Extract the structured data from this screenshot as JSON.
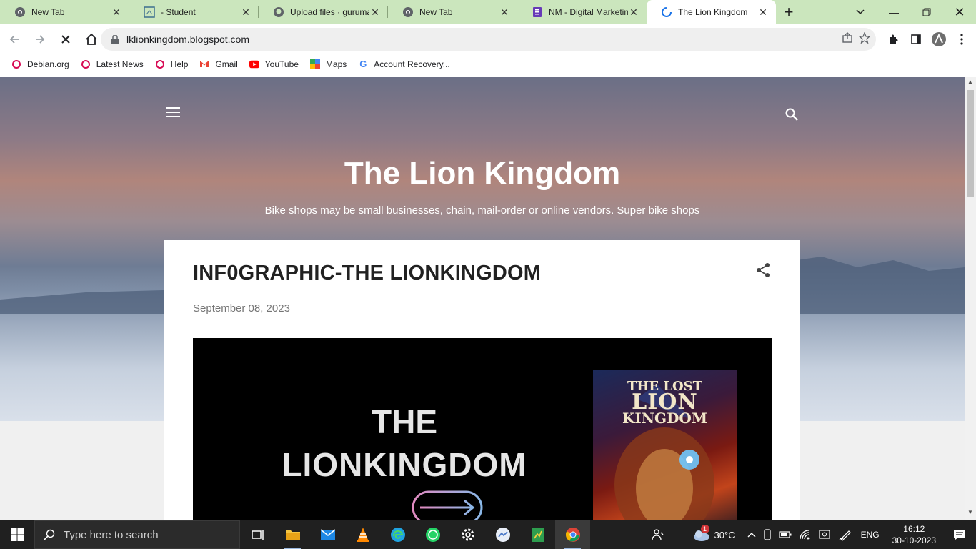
{
  "tabs": [
    {
      "title": "New Tab",
      "icon": "chrome-icon"
    },
    {
      "title": "- Student",
      "icon": "document-icon"
    },
    {
      "title": "Upload files · guruma",
      "icon": "github-icon"
    },
    {
      "title": "New Tab",
      "icon": "chrome-icon"
    },
    {
      "title": "NM - Digital Marketin",
      "icon": "forms-icon"
    },
    {
      "title": "The Lion Kingdom",
      "icon": "blogger-icon",
      "active": true
    }
  ],
  "address_bar": {
    "url": "lklionkingdom.blogspot.com"
  },
  "bookmarks": [
    {
      "label": "Debian.org"
    },
    {
      "label": "Latest News"
    },
    {
      "label": "Help"
    },
    {
      "label": "Gmail"
    },
    {
      "label": "YouTube"
    },
    {
      "label": "Maps"
    },
    {
      "label": "Account Recovery..."
    }
  ],
  "blog": {
    "title": "The Lion Kingdom",
    "description": "Bike shops may be small businesses, chain, mail-order or online vendors. Super bike shops",
    "post": {
      "title": "INF0GRAPHIC-THE LIONKINGDOM",
      "date": "September 08, 2023",
      "image_line1": "THE",
      "image_line2": "LIONKINGDOM",
      "poster_line1": "THE LOST",
      "poster_line2": "LION",
      "poster_line3": "KINGDOM"
    }
  },
  "taskbar": {
    "search_placeholder": "Type here to search",
    "weather": "30°C",
    "weather_badge": "1",
    "language": "ENG",
    "time": "16:12",
    "date": "30-10-2023"
  },
  "colors": {
    "tabstrip": "#cbe6bd",
    "taskbar": "#202020",
    "brand_blogger": "#e0475b"
  }
}
